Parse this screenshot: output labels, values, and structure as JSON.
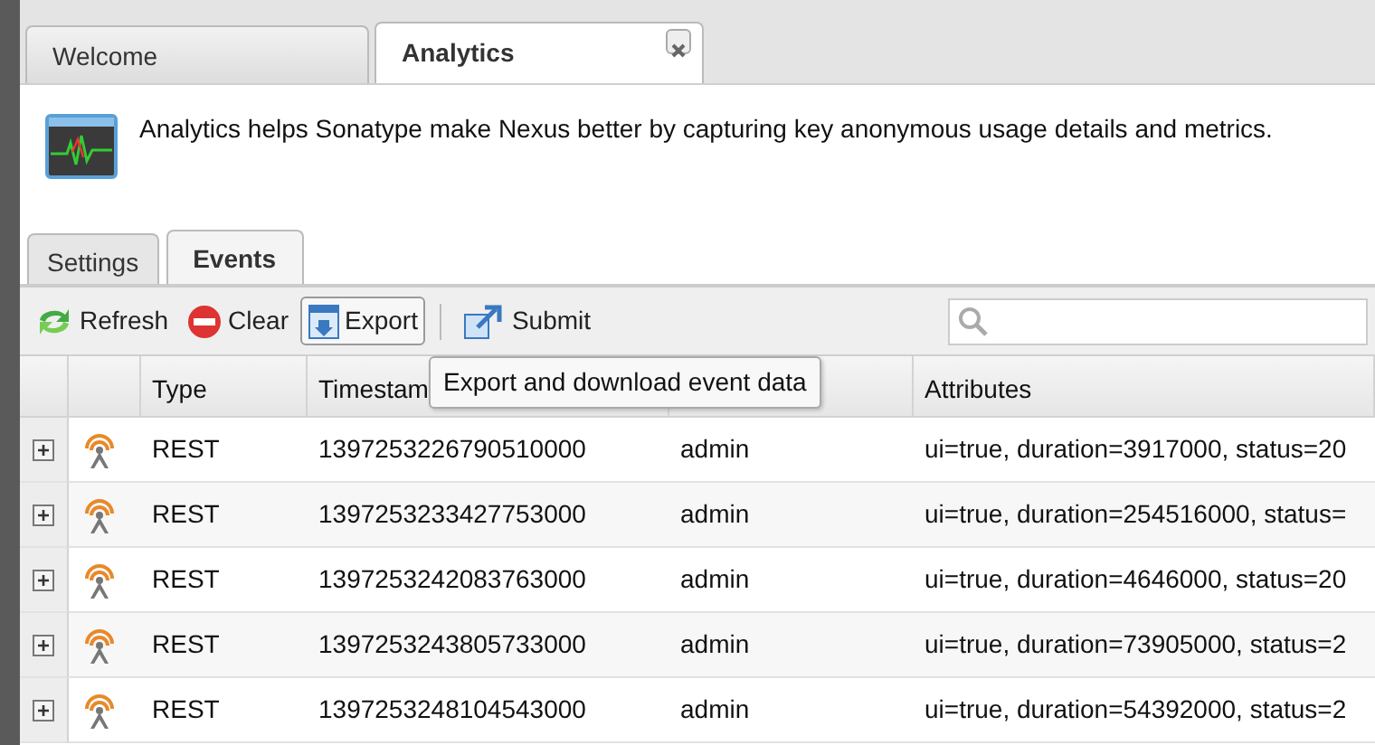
{
  "tabs": [
    {
      "label": "Welcome",
      "selected": false,
      "closable": false
    },
    {
      "label": "Analytics",
      "selected": true,
      "closable": true
    }
  ],
  "description": "Analytics helps Sonatype make Nexus better by capturing key anonymous usage details and metrics.",
  "subtabs": [
    {
      "label": "Settings",
      "selected": false
    },
    {
      "label": "Events",
      "selected": true
    }
  ],
  "toolbar": [
    {
      "kind": "button",
      "label": "Refresh",
      "hovered": false
    },
    {
      "kind": "button",
      "label": "Clear",
      "hovered": false
    },
    {
      "kind": "button",
      "label": "Export",
      "hovered": true
    },
    {
      "kind": "separator"
    },
    {
      "kind": "button",
      "label": "Submit",
      "hovered": false
    }
  ],
  "tooltip": "Export and download event data",
  "table": {
    "columns": [
      {
        "kind": "blank"
      },
      {
        "kind": "blank"
      },
      {
        "kind": "text",
        "label": "Type"
      },
      {
        "kind": "text",
        "label": "Timestam"
      },
      {
        "kind": "blank"
      },
      {
        "kind": "text",
        "label": "Attributes"
      }
    ],
    "rows": [
      {
        "expanded": false,
        "type": "REST",
        "timestamp": "1397253226790510000",
        "user": "admin",
        "attributes": "ui=true, duration=3917000, status=20"
      },
      {
        "expanded": false,
        "type": "REST",
        "timestamp": "1397253233427753000",
        "user": "admin",
        "attributes": "ui=true, duration=254516000, status="
      },
      {
        "expanded": false,
        "type": "REST",
        "timestamp": "1397253242083763000",
        "user": "admin",
        "attributes": "ui=true, duration=4646000, status=20"
      },
      {
        "expanded": false,
        "type": "REST",
        "timestamp": "1397253243805733000",
        "user": "admin",
        "attributes": "ui=true, duration=73905000, status=2"
      },
      {
        "expanded": false,
        "type": "REST",
        "timestamp": "1397253248104543000",
        "user": "admin",
        "attributes": "ui=true, duration=54392000, status=2"
      }
    ]
  }
}
